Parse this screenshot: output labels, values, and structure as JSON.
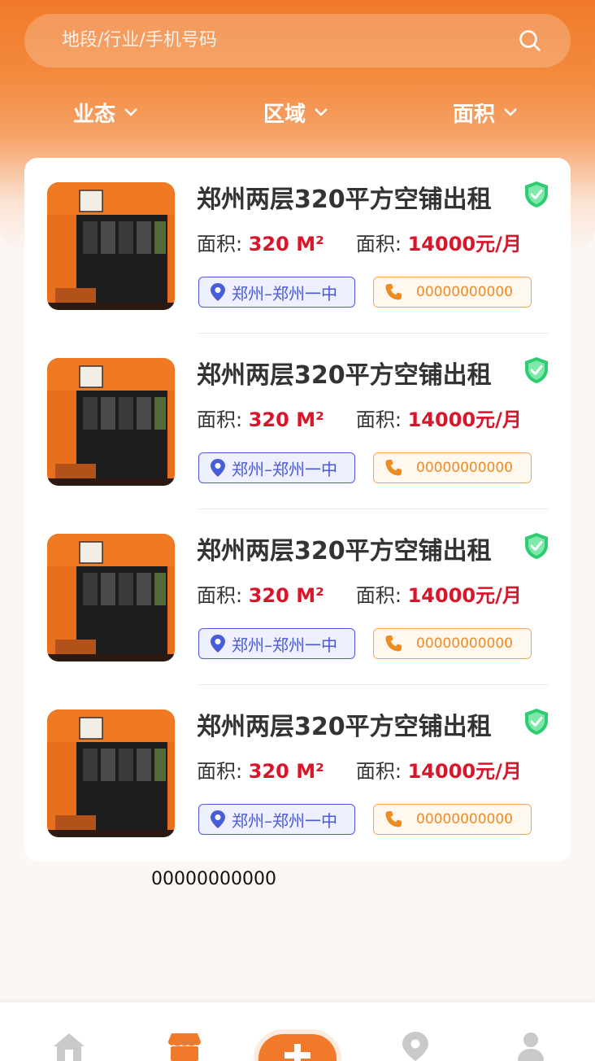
{
  "search": {
    "placeholder": "地段/行业/手机号码"
  },
  "filters": [
    {
      "label": "业态"
    },
    {
      "label": "区域"
    },
    {
      "label": "面积"
    }
  ],
  "listings": [
    {
      "title": "郑州两层320平方空铺出租",
      "area_label": "面积:",
      "area_value": "320 M²",
      "price_label": "面积:",
      "price_value": "14000元/月",
      "location": "郑州–郑州一中",
      "phone": "00000000000"
    },
    {
      "title": "郑州两层320平方空铺出租",
      "area_label": "面积:",
      "area_value": "320 M²",
      "price_label": "面积:",
      "price_value": "14000元/月",
      "location": "郑州–郑州一中",
      "phone": "00000000000"
    },
    {
      "title": "郑州两层320平方空铺出租",
      "area_label": "面积:",
      "area_value": "320 M²",
      "price_label": "面积:",
      "price_value": "14000元/月",
      "location": "郑州–郑州一中",
      "phone": "00000000000"
    },
    {
      "title": "郑州两层320平方空铺出租",
      "area_label": "面积:",
      "area_value": "320 M²",
      "price_label": "面积:",
      "price_value": "14000元/月",
      "location": "郑州–郑州一中",
      "phone": "00000000000"
    }
  ],
  "footer_phone": "00000000000",
  "tabbar": {
    "icons": [
      "home-icon",
      "shop-icon",
      "publish-plus-icon",
      "location-icon",
      "profile-icon"
    ]
  },
  "colors": {
    "brand_orange": "#f07a2a",
    "price_red": "#d8152a",
    "location_blue": "#4a5bd6",
    "phone_orange": "#f08a23",
    "verified_green": "#2ecc71"
  }
}
